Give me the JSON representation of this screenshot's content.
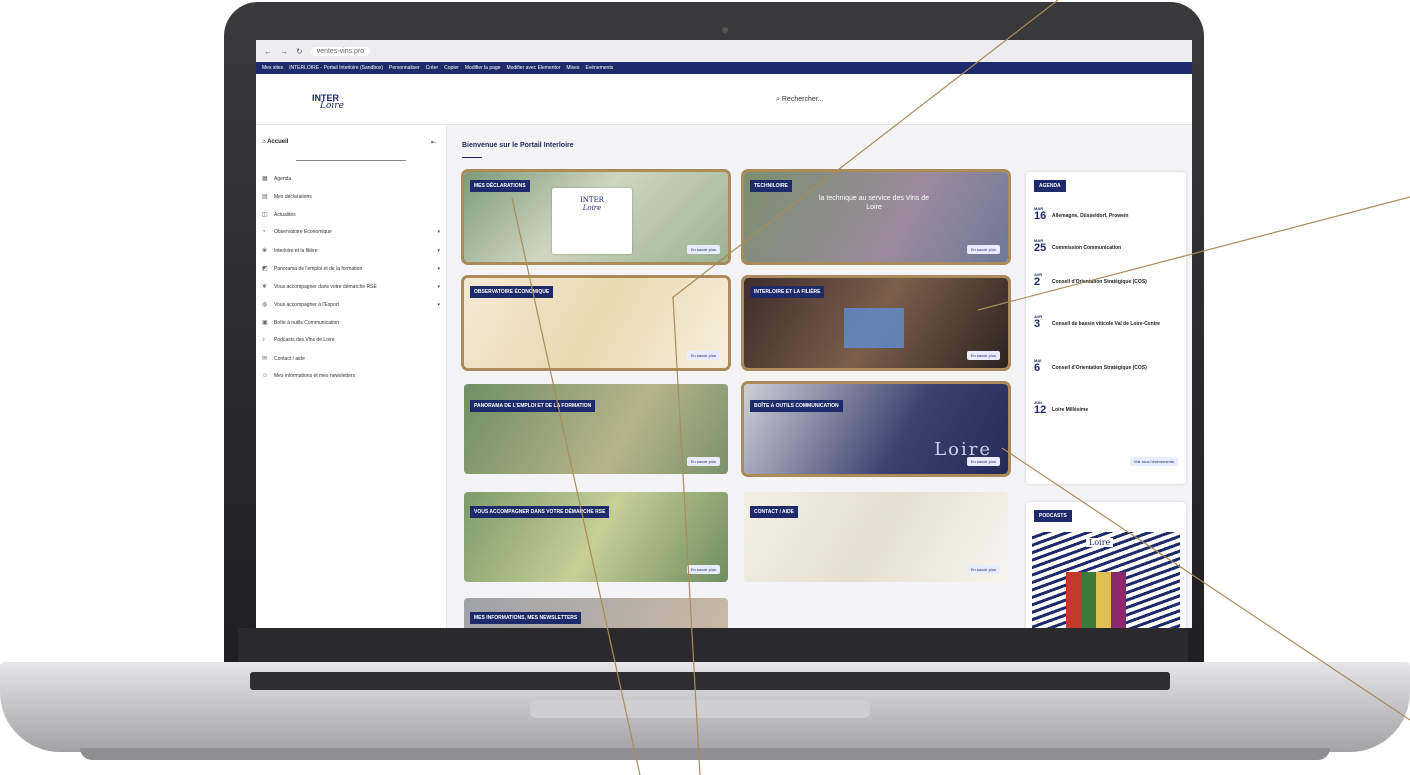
{
  "browser": {
    "url": "ventes-vins.pro"
  },
  "bookmarks": [
    "Mes sites",
    "INTERLOIRE - Portail Interloire (Sandbox)",
    "Personnaliser",
    "Créer",
    "Copier",
    "Modifier la page",
    "Modifier avec Elementor",
    "Mises",
    "Evénements"
  ],
  "header": {
    "logo_top": "INTER",
    "logo_bottom": "Loire",
    "search_placeholder": "Rechercher..."
  },
  "sidebar": {
    "home": "Accueil",
    "items": [
      {
        "label": "Agenda",
        "icon": "calendar-icon",
        "chevron": false
      },
      {
        "label": "Mes déclarations",
        "icon": "document-icon",
        "chevron": false
      },
      {
        "label": "Actualités",
        "icon": "news-icon",
        "chevron": false
      },
      {
        "label": "Observatoire Economique",
        "icon": "chart-icon",
        "chevron": true
      },
      {
        "label": "Interloire et la filière",
        "icon": "grape-icon",
        "chevron": true
      },
      {
        "label": "Panorama de l'emploi et de la formation",
        "icon": "briefcase-icon",
        "chevron": true
      },
      {
        "label": "Vous accompagner dans votre démarche RSE",
        "icon": "leaf-icon",
        "chevron": true
      },
      {
        "label": "Vous accompagner à l'Export",
        "icon": "globe-icon",
        "chevron": true
      },
      {
        "label": "Boîte à outils Communication",
        "icon": "toolbox-icon",
        "chevron": false
      },
      {
        "label": "Podcasts des Vins de Loire",
        "icon": "mic-icon",
        "chevron": false
      },
      {
        "label": "Contact / aide",
        "icon": "chat-icon",
        "chevron": false
      },
      {
        "label": "Mes informations et mes newsletters",
        "icon": "user-icon",
        "chevron": false
      }
    ]
  },
  "main": {
    "welcome": "Bienvenue sur le Portail Interloire",
    "cards": [
      {
        "label": "MES DÉCLARATIONS",
        "more": "En savoir plus",
        "doc_top": "INTER",
        "doc_bottom": "Loire"
      },
      {
        "label": "TECHNILOIRE",
        "more": "En savoir plus",
        "caption": "la technique au service des Vins de Loire"
      },
      {
        "label": "OBSERVATOIRE ÉCONOMIQUE",
        "more": "En savoir plus"
      },
      {
        "label": "INTERLOIRE ET LA FILIÈRE",
        "more": "En savoir plus"
      },
      {
        "label": "PANORAMA DE L'EMPLOI ET DE LA FORMATION",
        "more": "En savoir plus"
      },
      {
        "label": "BOÎTE À OUTILS COMMUNICATION",
        "more": "En savoir plus",
        "brand": "Loire"
      },
      {
        "label": "VOUS ACCOMPAGNER DANS VOTRE DÉMARCHE RSE",
        "more": "En savoir plus"
      },
      {
        "label": "CONTACT / AIDE",
        "more": "En savoir plus"
      },
      {
        "label": "MES INFORMATIONS, MES NEWSLETTERS"
      }
    ]
  },
  "agenda": {
    "tag": "AGENDA",
    "events": [
      {
        "month": "MAR",
        "day": "16",
        "title": "Allemagne, Düsseldorf, Prowein"
      },
      {
        "month": "MAR",
        "day": "25",
        "title": "Commission Communication"
      },
      {
        "month": "AVR",
        "day": "2",
        "title": "Conseil d'Orientation Stratégique (COS)"
      },
      {
        "month": "AVR",
        "day": "3",
        "title": "Conseil de bassin viticole Val de Loire-Centre"
      },
      {
        "month": "MAI",
        "day": "6",
        "title": "Conseil d'Orientation Stratégique (COS)"
      },
      {
        "month": "JUN",
        "day": "12",
        "title": "Loire Millésime"
      }
    ],
    "see_all": "Voir tous l'événements"
  },
  "podcasts": {
    "tag": "PODCASTS",
    "brand": "Loire"
  }
}
